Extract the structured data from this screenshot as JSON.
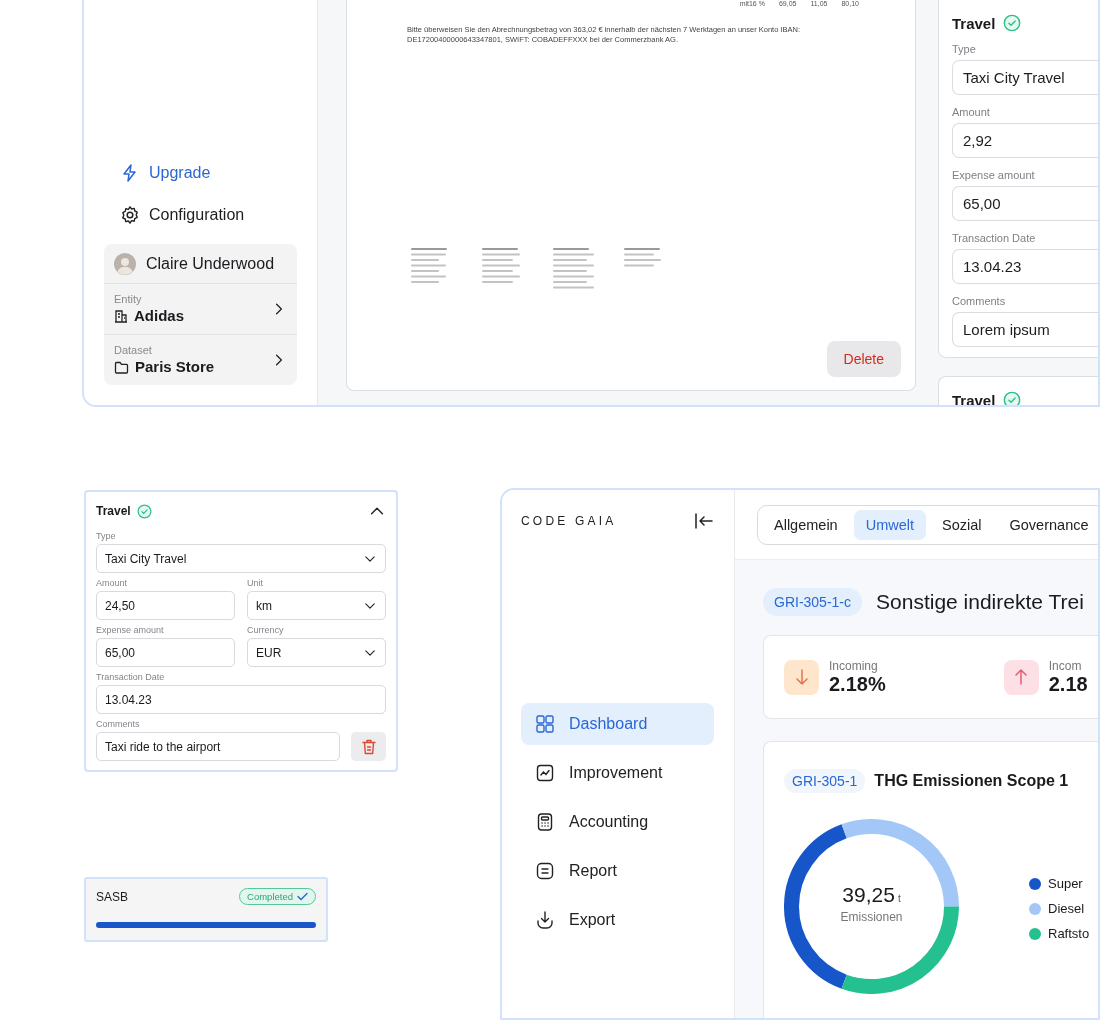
{
  "invoice_window": {
    "sidebar": {
      "links": [
        {
          "kind": "upgrade",
          "label": "Upgrade"
        },
        {
          "kind": "settings",
          "label": "Configuration"
        }
      ],
      "user": {
        "name": "Claire Underwood"
      },
      "context": [
        {
          "kind": "entity",
          "label": "Entity",
          "value": "Adidas"
        },
        {
          "kind": "dataset",
          "label": "Dataset",
          "value": "Paris Store"
        }
      ]
    },
    "document": {
      "totals": [
        "mit16 %",
        "69,05",
        "11,05",
        "80,10"
      ],
      "payment_note": "Bitte überweisen Sie den Abrechnungsbetrag von 363,02 € innerhalb der nächsten 7 Werktagen an unser Konto IBAN: DE17200400000643347801, SWIFT: COBADEFFXXX bei der Commerzbank AG.",
      "delete_button": "Delete"
    },
    "expense_cards": [
      {
        "title": "Travel",
        "verified": true,
        "fields": [
          {
            "label": "Type",
            "value": "Taxi City Travel"
          },
          {
            "label": "Amount",
            "value": "2,92"
          },
          {
            "label": "Expense amount",
            "value": "65,00"
          },
          {
            "label": "Transaction Date",
            "value": "13.04.23"
          },
          {
            "label": "Comments",
            "value": "Lorem ipsum"
          }
        ]
      },
      {
        "title": "Travel",
        "verified": true
      }
    ]
  },
  "travel_form": {
    "title": "Travel",
    "verified": true,
    "expanded": true,
    "rows": [
      [
        {
          "kind": "select",
          "label": "Type",
          "value": "Taxi City Travel"
        }
      ],
      [
        {
          "kind": "input",
          "label": "Amount",
          "value": "24,50"
        },
        {
          "kind": "select",
          "label": "Unit",
          "value": "km"
        }
      ],
      [
        {
          "kind": "input",
          "label": "Expense amount",
          "value": "65,00"
        },
        {
          "kind": "select",
          "label": "Currency",
          "value": "EUR"
        }
      ],
      [
        {
          "kind": "input",
          "label": "Transaction Date",
          "value": "13.04.23"
        }
      ],
      [
        {
          "kind": "comment",
          "label": "Comments",
          "value": "Taxi ride to the airport"
        }
      ]
    ]
  },
  "sasb": {
    "title": "SASB",
    "status": "Completed",
    "level": 1
  },
  "dashboard": {
    "logo": "CODE GAIA",
    "nav": [
      {
        "kind": "dashboard",
        "label": "Dashboard",
        "selected": true
      },
      {
        "kind": "improvement",
        "label": "Improvement",
        "selected": false
      },
      {
        "kind": "accounting",
        "label": "Accounting",
        "selected": false
      },
      {
        "kind": "report",
        "label": "Report",
        "selected": false
      },
      {
        "kind": "export",
        "label": "Export",
        "selected": false
      }
    ],
    "tabs": [
      {
        "label": "Allgemein",
        "selected": false
      },
      {
        "label": "Umwelt",
        "selected": true
      },
      {
        "label": "Sozial",
        "selected": false
      },
      {
        "label": "Governance",
        "selected": false
      }
    ],
    "header": {
      "code": "GRI-305-1-c",
      "title": "Sonstige indirekte Trei"
    },
    "stats": [
      {
        "kind": "down",
        "label": "Incoming",
        "value": "2.18%"
      },
      {
        "kind": "up",
        "label": "Incom",
        "value": "2.18"
      }
    ],
    "emissions": {
      "code": "GRI-305-1",
      "title": "THG Emissionen Scope 1",
      "total": "39,25",
      "unit": "t",
      "caption": "Emissionen",
      "legend": [
        {
          "label": "Super",
          "color": "#1756c8"
        },
        {
          "label": "Diesel",
          "color": "#a3c8f8"
        },
        {
          "label": "Raftsto",
          "color": "#25c08f"
        }
      ]
    }
  }
}
